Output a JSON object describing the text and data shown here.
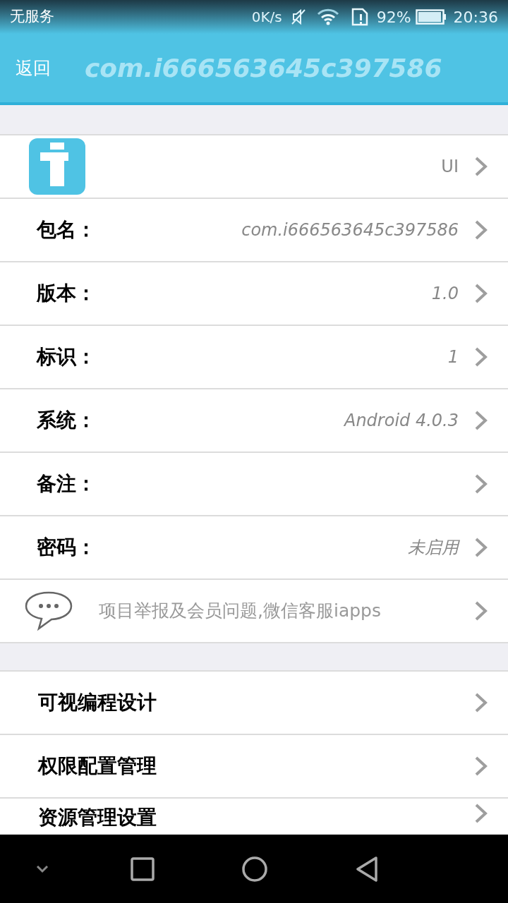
{
  "status_bar": {
    "carrier": "无服务",
    "speed": "0K/s",
    "battery_percent": "92%",
    "time": "20:36"
  },
  "header": {
    "back": "返回",
    "title": "com.i666563645c397586"
  },
  "info_rows": [
    {
      "kind": "icon",
      "value": "UI"
    },
    {
      "kind": "field",
      "label": "包名：",
      "value": "com.i666563645c397586"
    },
    {
      "kind": "field",
      "label": "版本：",
      "value": "1.0"
    },
    {
      "kind": "field",
      "label": "标识：",
      "value": "1"
    },
    {
      "kind": "field",
      "label": "系统：",
      "value": "Android 4.0.3"
    },
    {
      "kind": "field",
      "label": "备注："
    },
    {
      "kind": "field",
      "label": "密码：",
      "value": "未启用"
    },
    {
      "kind": "notice",
      "text": "项目举报及会员问题,微信客服iapps"
    }
  ],
  "menu_rows": [
    {
      "label": "可视编程设计"
    },
    {
      "label": "权限配置管理"
    },
    {
      "label": "资源管理设置"
    }
  ]
}
